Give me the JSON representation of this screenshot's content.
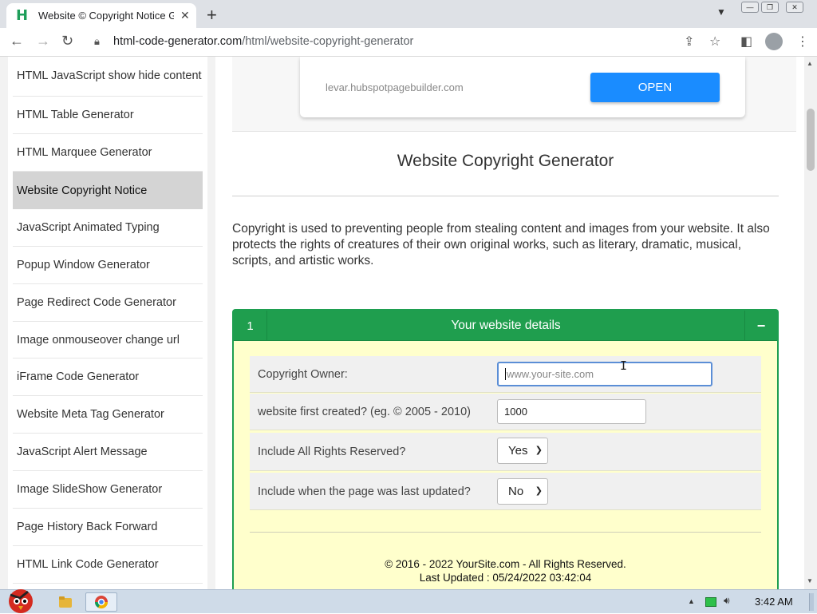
{
  "browser": {
    "tab_title": "Website © Copyright Notice G",
    "favicon_letter": "H",
    "url_host": "html-code-generator.com",
    "url_path": "/html/website-copyright-generator"
  },
  "sidebar": {
    "items": [
      {
        "label": "HTML JavaScript show hide content",
        "active": false
      },
      {
        "label": "HTML Table Generator",
        "active": false
      },
      {
        "label": "HTML Marquee Generator",
        "active": false
      },
      {
        "label": "Website Copyright Notice",
        "active": true
      },
      {
        "label": "JavaScript Animated Typing",
        "active": false
      },
      {
        "label": "Popup Window Generator",
        "active": false
      },
      {
        "label": "Page Redirect Code Generator",
        "active": false
      },
      {
        "label": "Image onmouseover change url",
        "active": false
      },
      {
        "label": "iFrame Code Generator",
        "active": false
      },
      {
        "label": "Website Meta Tag Generator",
        "active": false
      },
      {
        "label": "JavaScript Alert Message",
        "active": false
      },
      {
        "label": "Image SlideShow Generator",
        "active": false
      },
      {
        "label": "Page History Back Forward",
        "active": false
      },
      {
        "label": "HTML Link Code Generator",
        "active": false
      }
    ]
  },
  "ad": {
    "domain": "levar.hubspotpagebuilder.com",
    "button_label": "OPEN"
  },
  "main": {
    "title": "Website Copyright Generator",
    "intro": "Copyright is used to preventing people from stealing content and images from your website. It also protects the rights of creatures of their own original works, such as literary, dramatic, musical, scripts, and artistic works."
  },
  "panel": {
    "number": "1",
    "title": "Your website details",
    "toggle": "−",
    "fields": {
      "owner": {
        "label": "Copyright Owner:",
        "value": "",
        "placeholder": "www.your-site.com"
      },
      "created": {
        "label": "website first created? (eg. © 2005 - 2010)",
        "value": "1000"
      },
      "rights": {
        "label": "Include All Rights Reserved?",
        "selected": "Yes"
      },
      "updated": {
        "label": "Include when the page was last updated?",
        "selected": "No"
      }
    },
    "preview": {
      "line1": "© 2016 - 2022 YourSite.com - All Rights Reserved.",
      "line2": "Last Updated : 05/24/2022 03:42:04"
    }
  },
  "taskbar": {
    "time": "3:42 AM"
  },
  "colors": {
    "accent_green": "#1f9e4e",
    "panel_bg": "#ffffcc",
    "open_button": "#1a8cff",
    "active_sidebar": "#d4d4d4"
  },
  "icons": [
    "back-icon",
    "forward-icon",
    "reload-icon",
    "lock-icon",
    "share-icon",
    "star-icon",
    "sidepanel-icon",
    "profile-icon",
    "menu-icon",
    "close-icon",
    "new-tab-icon",
    "chevron-down-icon"
  ]
}
